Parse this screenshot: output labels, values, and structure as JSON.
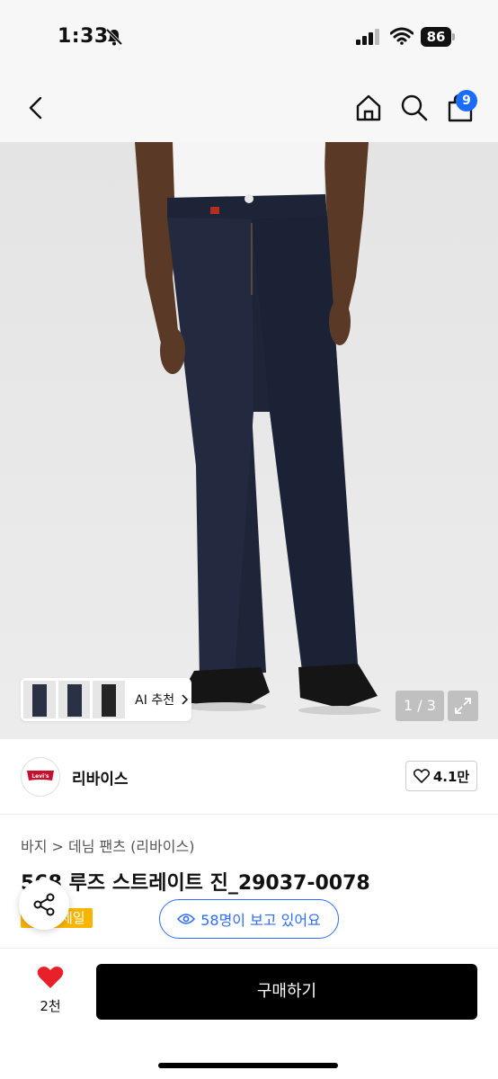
{
  "status_bar": {
    "time": "1:33",
    "battery": "86"
  },
  "nav": {
    "cart_count": "9"
  },
  "gallery": {
    "ai_label": "AI 추천",
    "page_counter": "1 / 3"
  },
  "brand": {
    "logo_text": "Levi's",
    "name": "리바이스",
    "likes": "4.1만"
  },
  "product": {
    "breadcrumb": "바지 > 데님 팬츠 (리바이스)",
    "title": "568 루즈 스트레이트 진_29037-0078",
    "sale_badge": "세일",
    "viewers": "58명이 보고 있어요"
  },
  "bottom": {
    "wish_count": "2천",
    "buy_label": "구매하기"
  },
  "colors": {
    "accent_blue": "#2e6bff",
    "cart_badge": "#1a6cff",
    "sale_yellow": "#f7b500",
    "heart_red": "#e8202a"
  }
}
